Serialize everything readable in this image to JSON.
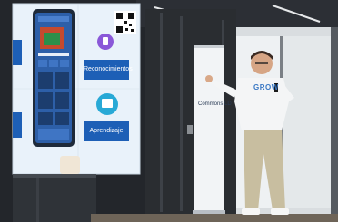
{
  "screen": {
    "button_top": "Reconocimientos",
    "button_bottom": "Aprendizaje"
  },
  "speaker": {
    "shirt_text": "GROW"
  },
  "banner": {
    "text": "Commons LD"
  },
  "colors": {
    "screen_light": "#e9f2fa",
    "screen_blue": "#1d5fb6",
    "icon_purple": "#8a58d8",
    "icon_teal": "#28a9d6",
    "shirt": "#f4f5f6",
    "trousers": "#c8bea0",
    "wall_dark": "#1f2226"
  }
}
